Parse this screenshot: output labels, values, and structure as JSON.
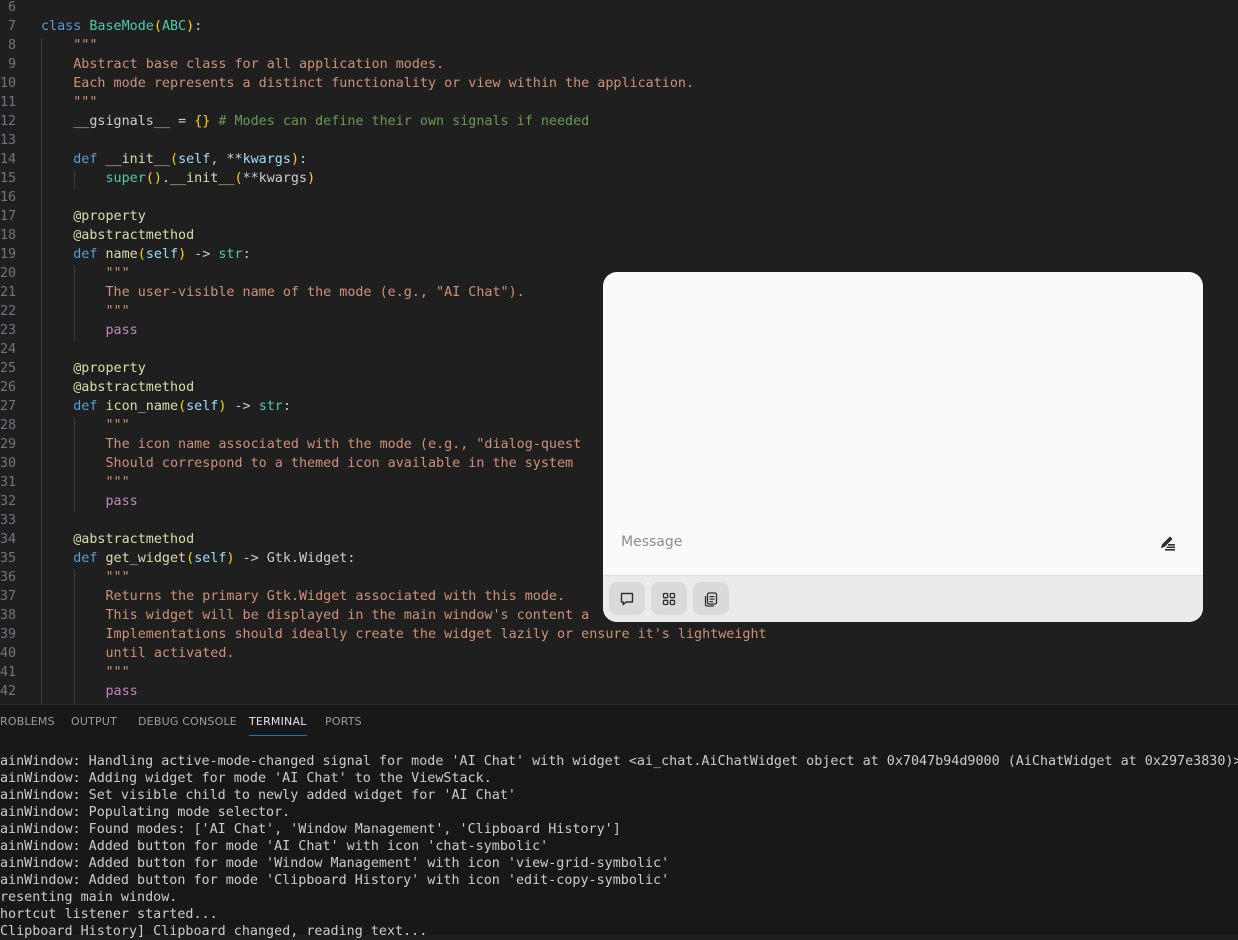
{
  "editor": {
    "lines": [
      {
        "num": "6",
        "spans": []
      },
      {
        "num": "7",
        "spans": [
          [
            "kw",
            "class"
          ],
          [
            "plain",
            " "
          ],
          [
            "cls",
            "BaseMode"
          ],
          [
            "br1",
            "("
          ],
          [
            "cls",
            "ABC"
          ],
          [
            "br1",
            ")"
          ],
          [
            "plain",
            ":"
          ]
        ]
      },
      {
        "num": "8",
        "spans": [
          [
            "plain",
            "    "
          ],
          [
            "str",
            "\"\"\""
          ]
        ]
      },
      {
        "num": "9",
        "spans": [
          [
            "plain",
            "    "
          ],
          [
            "str",
            "Abstract base class for all application modes."
          ]
        ]
      },
      {
        "num": "10",
        "spans": [
          [
            "plain",
            "    "
          ],
          [
            "str",
            "Each mode represents a distinct functionality or view within the application."
          ]
        ]
      },
      {
        "num": "11",
        "spans": [
          [
            "plain",
            "    "
          ],
          [
            "str",
            "\"\"\""
          ]
        ]
      },
      {
        "num": "12",
        "spans": [
          [
            "plain",
            "    __gsignals__ = "
          ],
          [
            "br1",
            "{}"
          ],
          [
            "plain",
            " "
          ],
          [
            "cm",
            "# Modes can define their own signals if needed"
          ]
        ]
      },
      {
        "num": "13",
        "spans": []
      },
      {
        "num": "14",
        "spans": [
          [
            "plain",
            "    "
          ],
          [
            "kw",
            "def"
          ],
          [
            "plain",
            " "
          ],
          [
            "fn",
            "__init__"
          ],
          [
            "br1",
            "("
          ],
          [
            "par",
            "self"
          ],
          [
            "plain",
            ", **"
          ],
          [
            "par",
            "kwargs"
          ],
          [
            "br1",
            ")"
          ],
          [
            "plain",
            ":"
          ]
        ]
      },
      {
        "num": "15",
        "spans": [
          [
            "plain",
            "        "
          ],
          [
            "cls",
            "super"
          ],
          [
            "br1",
            "()"
          ],
          [
            "plain",
            "."
          ],
          [
            "fn",
            "__init__"
          ],
          [
            "br1",
            "("
          ],
          [
            "plain",
            "**kwargs"
          ],
          [
            "br1",
            ")"
          ]
        ]
      },
      {
        "num": "16",
        "spans": []
      },
      {
        "num": "17",
        "spans": [
          [
            "plain",
            "    "
          ],
          [
            "fn",
            "@property"
          ]
        ]
      },
      {
        "num": "18",
        "spans": [
          [
            "plain",
            "    "
          ],
          [
            "fn",
            "@abstractmethod"
          ]
        ]
      },
      {
        "num": "19",
        "spans": [
          [
            "plain",
            "    "
          ],
          [
            "kw",
            "def"
          ],
          [
            "plain",
            " "
          ],
          [
            "fn",
            "name"
          ],
          [
            "br1",
            "("
          ],
          [
            "par",
            "self"
          ],
          [
            "br1",
            ")"
          ],
          [
            "plain",
            " -> "
          ],
          [
            "cls",
            "str"
          ],
          [
            "plain",
            ":"
          ]
        ]
      },
      {
        "num": "20",
        "spans": [
          [
            "plain",
            "        "
          ],
          [
            "str",
            "\"\"\""
          ]
        ]
      },
      {
        "num": "21",
        "spans": [
          [
            "plain",
            "        "
          ],
          [
            "str",
            "The user-visible name of the mode (e.g., \"AI Chat\")."
          ]
        ]
      },
      {
        "num": "22",
        "spans": [
          [
            "plain",
            "        "
          ],
          [
            "str",
            "\"\"\""
          ]
        ]
      },
      {
        "num": "23",
        "spans": [
          [
            "plain",
            "        "
          ],
          [
            "ctl",
            "pass"
          ]
        ]
      },
      {
        "num": "24",
        "spans": []
      },
      {
        "num": "25",
        "spans": [
          [
            "plain",
            "    "
          ],
          [
            "fn",
            "@property"
          ]
        ]
      },
      {
        "num": "26",
        "spans": [
          [
            "plain",
            "    "
          ],
          [
            "fn",
            "@abstractmethod"
          ]
        ]
      },
      {
        "num": "27",
        "spans": [
          [
            "plain",
            "    "
          ],
          [
            "kw",
            "def"
          ],
          [
            "plain",
            " "
          ],
          [
            "fn",
            "icon_name"
          ],
          [
            "br1",
            "("
          ],
          [
            "par",
            "self"
          ],
          [
            "br1",
            ")"
          ],
          [
            "plain",
            " -> "
          ],
          [
            "cls",
            "str"
          ],
          [
            "plain",
            ":"
          ]
        ]
      },
      {
        "num": "28",
        "spans": [
          [
            "plain",
            "        "
          ],
          [
            "str",
            "\"\"\""
          ]
        ]
      },
      {
        "num": "29",
        "spans": [
          [
            "plain",
            "        "
          ],
          [
            "str",
            "The icon name associated with the mode (e.g., \"dialog-quest"
          ]
        ]
      },
      {
        "num": "30",
        "spans": [
          [
            "plain",
            "        "
          ],
          [
            "str",
            "Should correspond to a themed icon available in the system"
          ]
        ]
      },
      {
        "num": "31",
        "spans": [
          [
            "plain",
            "        "
          ],
          [
            "str",
            "\"\"\""
          ]
        ]
      },
      {
        "num": "32",
        "spans": [
          [
            "plain",
            "        "
          ],
          [
            "ctl",
            "pass"
          ]
        ]
      },
      {
        "num": "33",
        "spans": []
      },
      {
        "num": "34",
        "spans": [
          [
            "plain",
            "    "
          ],
          [
            "fn",
            "@abstractmethod"
          ]
        ]
      },
      {
        "num": "35",
        "spans": [
          [
            "plain",
            "    "
          ],
          [
            "kw",
            "def"
          ],
          [
            "plain",
            " "
          ],
          [
            "fn",
            "get_widget"
          ],
          [
            "br1",
            "("
          ],
          [
            "par",
            "self"
          ],
          [
            "br1",
            ")"
          ],
          [
            "plain",
            " -> Gtk.Widget:"
          ]
        ]
      },
      {
        "num": "36",
        "spans": [
          [
            "plain",
            "        "
          ],
          [
            "str",
            "\"\"\""
          ]
        ]
      },
      {
        "num": "37",
        "spans": [
          [
            "plain",
            "        "
          ],
          [
            "str",
            "Returns the primary Gtk.Widget associated with this mode."
          ]
        ]
      },
      {
        "num": "38",
        "spans": [
          [
            "plain",
            "        "
          ],
          [
            "str",
            "This widget will be displayed in the main window's content a"
          ]
        ]
      },
      {
        "num": "39",
        "spans": [
          [
            "plain",
            "        "
          ],
          [
            "str",
            "Implementations should ideally create the widget lazily or ensure it's lightweight"
          ]
        ]
      },
      {
        "num": "40",
        "spans": [
          [
            "plain",
            "        "
          ],
          [
            "str",
            "until activated."
          ]
        ]
      },
      {
        "num": "41",
        "spans": [
          [
            "plain",
            "        "
          ],
          [
            "str",
            "\"\"\""
          ]
        ]
      },
      {
        "num": "42",
        "spans": [
          [
            "plain",
            "        "
          ],
          [
            "ctl",
            "pass"
          ]
        ]
      }
    ]
  },
  "panel": {
    "tabs": [
      {
        "label": "ROBLEMS",
        "active": false
      },
      {
        "label": "OUTPUT",
        "active": false
      },
      {
        "label": "DEBUG CONSOLE",
        "active": false
      },
      {
        "label": "TERMINAL",
        "active": true
      },
      {
        "label": "PORTS",
        "active": false
      }
    ],
    "terminal_lines": [
      "ainWindow: Handling active-mode-changed signal for mode 'AI Chat' with widget <ai_chat.AiChatWidget object at 0x7047b94d9000 (AiChatWidget at 0x297e3830)>",
      "ainWindow: Adding widget for mode 'AI Chat' to the ViewStack.",
      "ainWindow: Set visible child to newly added widget for 'AI Chat'",
      "ainWindow: Populating mode selector.",
      "ainWindow: Found modes: ['AI Chat', 'Window Management', 'Clipboard History']",
      "ainWindow: Added button for mode 'AI Chat' with icon 'chat-symbolic'",
      "ainWindow: Added button for mode 'Window Management' with icon 'view-grid-symbolic'",
      "ainWindow: Added button for mode 'Clipboard History' with icon 'edit-copy-symbolic'",
      "resenting main window.",
      "hortcut listener started...",
      "Clipboard History] Clipboard changed, reading text..."
    ]
  },
  "chat": {
    "input_placeholder": "Message",
    "input_value": "",
    "send_icon": "edit-send-icon",
    "mode_buttons": [
      {
        "name": "ai-chat-mode-button",
        "icon": "chat-icon"
      },
      {
        "name": "window-management-mode-button",
        "icon": "view-grid-icon"
      },
      {
        "name": "clipboard-history-mode-button",
        "icon": "edit-copy-icon"
      }
    ],
    "colors": {
      "background": "#fafafa",
      "toolbar": "#ebebeb",
      "button": "#dadada"
    }
  }
}
